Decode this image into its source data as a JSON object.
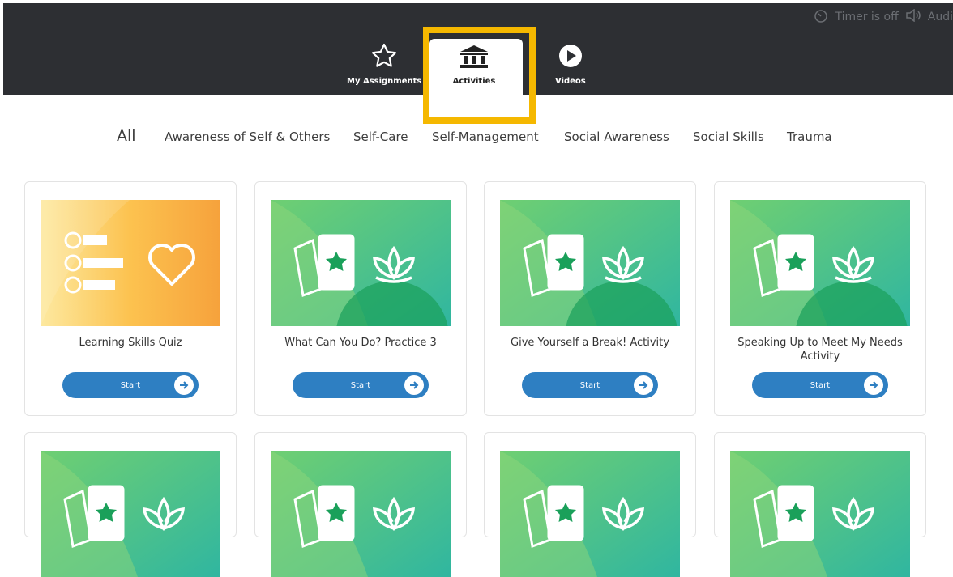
{
  "header": {
    "timer_label": "Timer is off",
    "audio_label": "Audi",
    "tabs": [
      {
        "label": "My Assignments",
        "icon": "star-icon"
      },
      {
        "label": "Activities",
        "icon": "bank-icon"
      },
      {
        "label": "Videos",
        "icon": "play-icon"
      }
    ],
    "active_tab": "Activities"
  },
  "filters": [
    "All",
    "Awareness of Self & Others",
    "Self-Care",
    "Self-Management",
    "Social Awareness",
    "Social Skills",
    "Trauma"
  ],
  "cards": [
    {
      "title": "Learning Skills Quiz",
      "button": "Start",
      "thumb": "quiz"
    },
    {
      "title": "What Can You Do? Practice 3",
      "button": "Start",
      "thumb": "cards-lotus"
    },
    {
      "title": "Give Yourself a Break! Activity",
      "button": "Start",
      "thumb": "cards-lotus"
    },
    {
      "title": "Speaking Up to Meet My Needs Activity",
      "button": "Start",
      "thumb": "cards-lotus"
    },
    {
      "title": "",
      "button": "",
      "thumb": "cards-lotus"
    },
    {
      "title": "",
      "button": "",
      "thumb": "cards-lotus"
    },
    {
      "title": "",
      "button": "",
      "thumb": "cards-lotus"
    },
    {
      "title": "",
      "button": "",
      "thumb": "cards-lotus"
    }
  ],
  "colors": {
    "topbar": "#2d2f33",
    "highlight": "#f5b800",
    "button": "#2e7fc2",
    "green": "#3cb878",
    "orange": "#f6a23c"
  }
}
